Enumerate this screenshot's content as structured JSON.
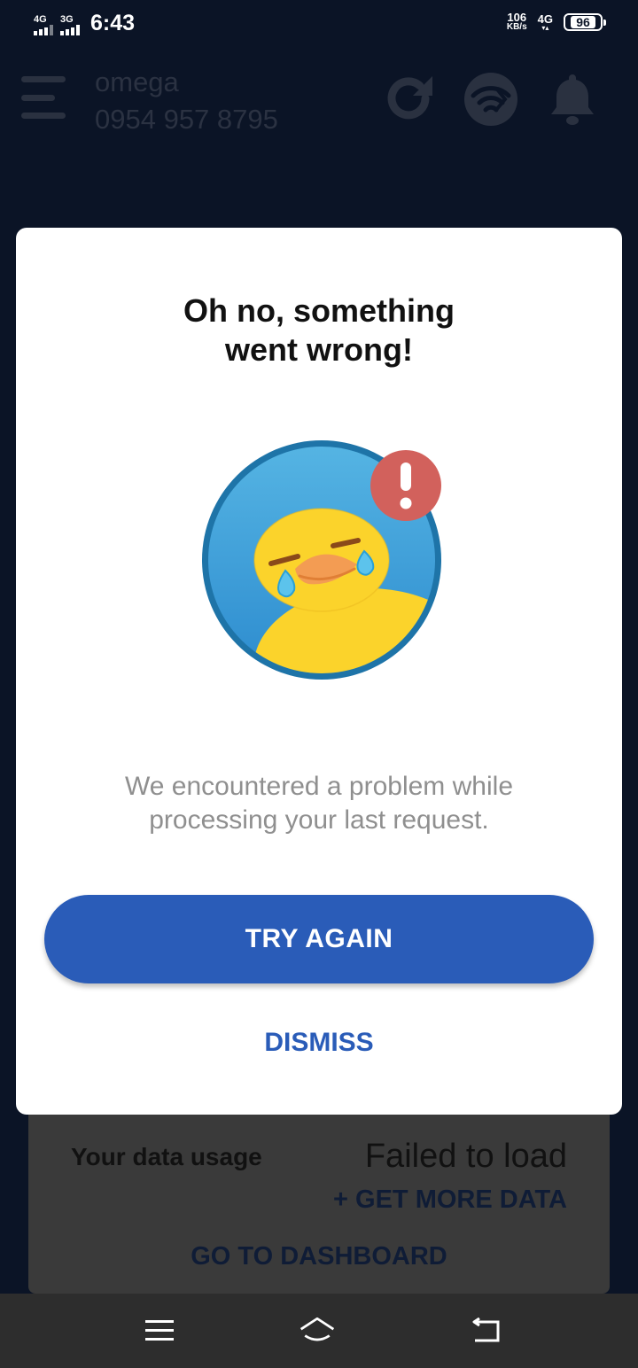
{
  "status_bar": {
    "sim1": "4G",
    "sim2": "3G",
    "time": "6:43",
    "speed_value": "106",
    "speed_unit": "KB/s",
    "network": "4G",
    "battery": "96"
  },
  "header": {
    "account_name": "omega",
    "phone_number": "0954 957 8795",
    "icons": [
      "menu-icon",
      "refresh-icon",
      "wifi-icon",
      "bell-icon"
    ]
  },
  "modal": {
    "title_line1": "Oh no, something",
    "title_line2": "went wrong!",
    "message_line1": "We encountered a problem while",
    "message_line2": "processing your last request.",
    "primary_button": "TRY AGAIN",
    "secondary_button": "DISMISS",
    "illustration": "crying-duck-icon",
    "badge": "!"
  },
  "background_card": {
    "usage_label": "Your data usage",
    "usage_value": "Failed to load",
    "more_data": "+ GET MORE DATA",
    "dashboard": "GO TO DASHBOARD"
  },
  "nav": {
    "icons": [
      "recents-icon",
      "home-icon",
      "back-icon"
    ]
  },
  "colors": {
    "app_background": "#0b1426",
    "accent": "#2a5cb8",
    "error_badge": "#d2615c",
    "duck": "#fbd32b"
  }
}
